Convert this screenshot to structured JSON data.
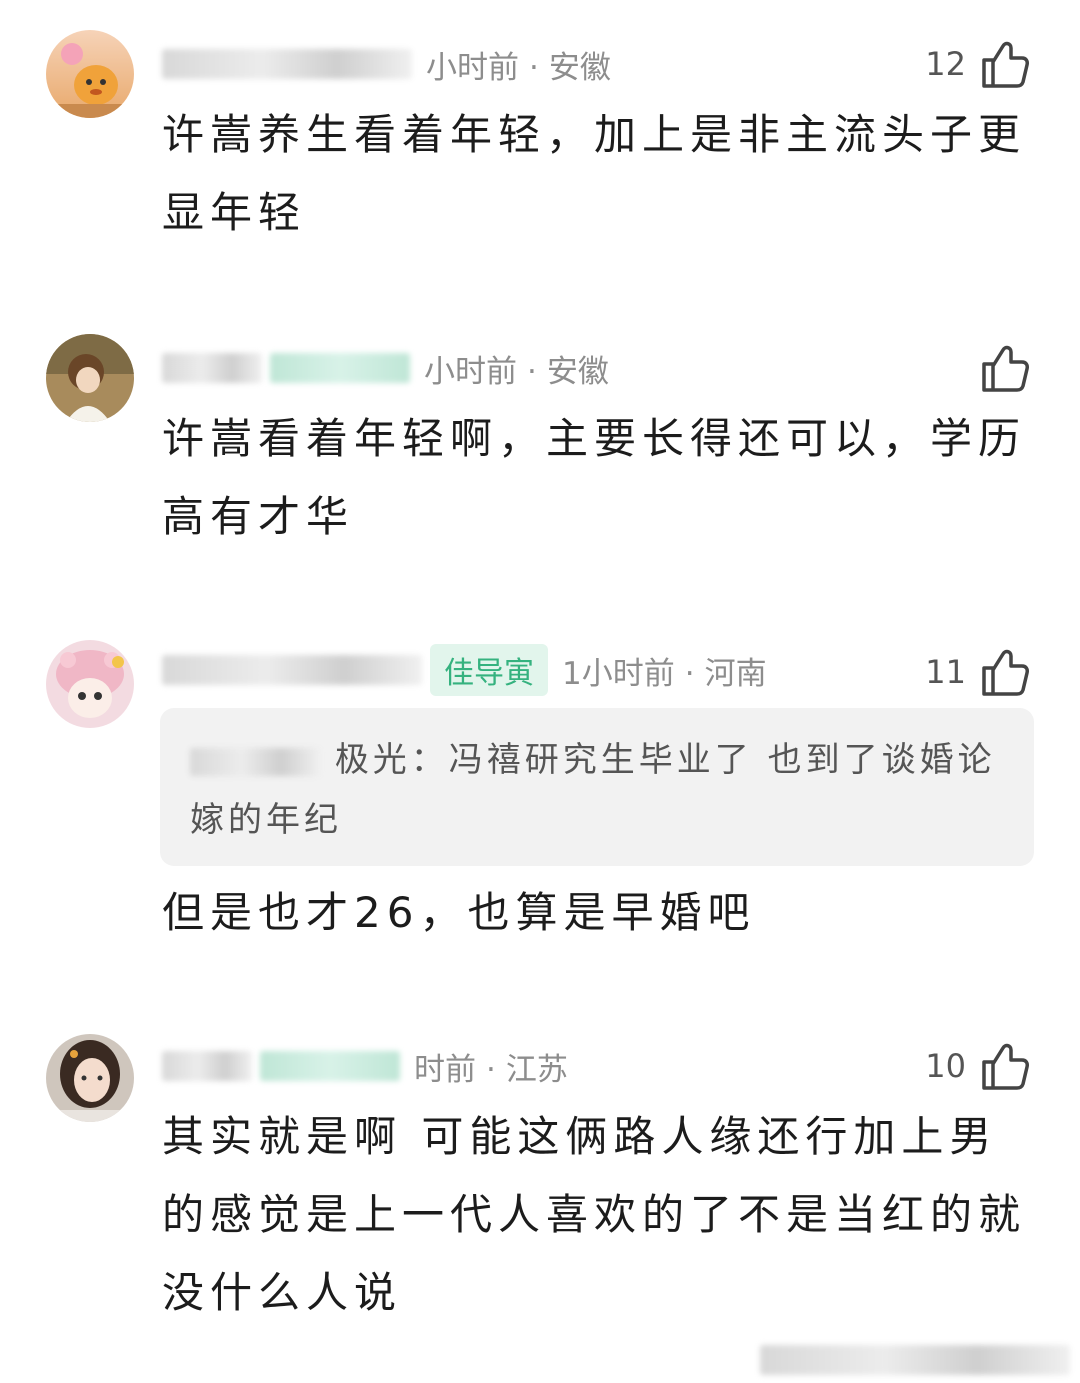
{
  "comments": [
    {
      "time": "小时前",
      "location": "安徽",
      "likes": "12",
      "text": "许嵩养生看着年轻，加上是非主流头子更显年轻"
    },
    {
      "time": "小时前",
      "location": "安徽",
      "likes": "",
      "text": "许嵩看着年轻啊，主要长得还可以，学历高有才华"
    },
    {
      "badge": "佳导寅",
      "time": "1小时前",
      "location": "河南",
      "likes": "11",
      "quote": "极光：冯禧研究生毕业了 也到了谈婚论嫁的年纪",
      "text": "但是也才26，也算是早婚吧"
    },
    {
      "time": "时前",
      "location": "江苏",
      "likes": "10",
      "text": "其实就是啊 可能这俩路人缘还行加上男的感觉是上一代人喜欢的了不是当红的就没什么人说"
    }
  ],
  "icons": {
    "like": "thumbs-up-icon"
  },
  "colors": {
    "badge_green": "#35b27f",
    "meta_gray": "#8d8d8d",
    "quote_bg": "#f2f2f2"
  }
}
